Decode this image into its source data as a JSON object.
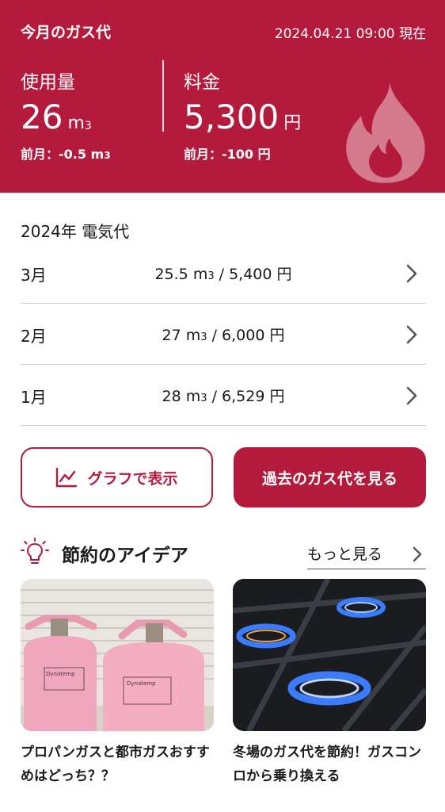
{
  "header": {
    "title": "今月のガス代",
    "datetime": "2024.04.21 09:00 現在",
    "usage": {
      "label": "使用量",
      "value": "26",
      "unit": "m",
      "unit_sup": "3",
      "prev_label": "前月：-0.5 m",
      "prev_sup": "3"
    },
    "fee": {
      "label": "料金",
      "value": "5,300",
      "unit": "円",
      "prev_label": "前月：-100 円"
    }
  },
  "history": {
    "title": "2024年 電気代",
    "rows": [
      {
        "month": "3月",
        "amount": "25.5 m",
        "sup": "3",
        "price": " / 5,400 円"
      },
      {
        "month": "2月",
        "amount": "27 m",
        "sup": "3",
        "price": " / 6,000 円"
      },
      {
        "month": "1月",
        "amount": "28 m",
        "sup": "3",
        "price": " / 6,529 円"
      }
    ]
  },
  "buttons": {
    "graph": "グラフで表示",
    "past": "過去のガス代を見る"
  },
  "ideas": {
    "title": "節約のアイデア",
    "more": "もっと見る",
    "cards": [
      {
        "caption": "プロパンガスと都市ガスおすすめはどっち？？",
        "icon": "propane-tanks-photo"
      },
      {
        "caption": "冬場のガス代を節約！ガスコンロから乗り換える",
        "icon": "gas-stove-flame-photo"
      }
    ]
  },
  "colors": {
    "accent": "#b41a3c"
  }
}
